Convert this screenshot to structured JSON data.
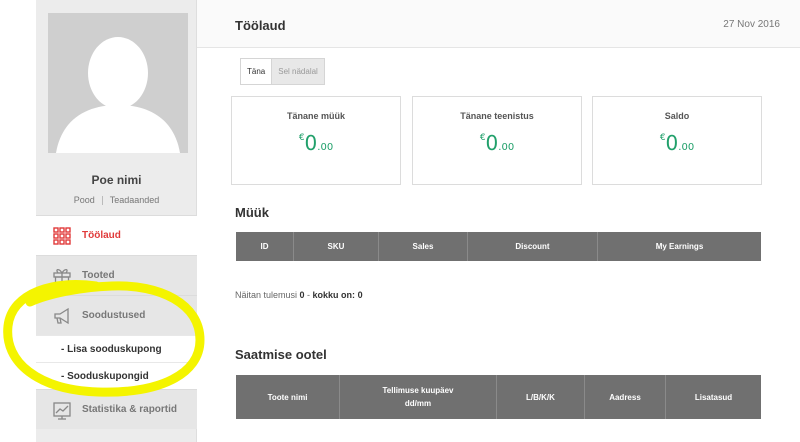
{
  "sidebar": {
    "store_name": "Poe nimi",
    "links": [
      "Pood",
      "Teadaanded"
    ],
    "menu": [
      {
        "label": "Töölaud",
        "icon": "grid-icon",
        "active": true
      },
      {
        "label": "Tooted",
        "icon": "gift-icon",
        "active": false
      },
      {
        "label": "Soodustused",
        "icon": "megaphone-icon",
        "active": false
      }
    ],
    "submenu": [
      "- Lisa sooduskupong",
      "- Sooduskupongid"
    ],
    "menu_bottom": {
      "label": "Statistika & raportid",
      "icon": "chart-icon"
    }
  },
  "header": {
    "title": "Töölaud",
    "date": "27 Nov 2016"
  },
  "tabs": [
    "Täna",
    "Sel nädalal"
  ],
  "cards": [
    {
      "title": "Tänane müük",
      "currency": "€",
      "whole": "0",
      "fraction": ".00"
    },
    {
      "title": "Tänane teenistus",
      "currency": "€",
      "whole": "0",
      "fraction": ".00"
    },
    {
      "title": "Saldo",
      "currency": "€",
      "whole": "0",
      "fraction": ".00"
    }
  ],
  "sales": {
    "title": "Müük",
    "columns": [
      "ID",
      "SKU",
      "Sales",
      "Discount",
      "My Earnings"
    ],
    "results_prefix": "Näitan tulemusi ",
    "results_from": "0",
    "results_mid": " - ",
    "results_total_label": "kokku on: ",
    "results_total": "0"
  },
  "pending": {
    "title": "Saatmise ootel",
    "columns": [
      "Toote nimi",
      "Tellimuse kuupäev\ndd/mm",
      "L/B/K/K",
      "Aadress",
      "Lisatasud"
    ]
  },
  "colors": {
    "accent_red": "#e03a3a",
    "value_green": "#21a06b",
    "table_header": "#707070",
    "marker_yellow": "#f4f400"
  }
}
